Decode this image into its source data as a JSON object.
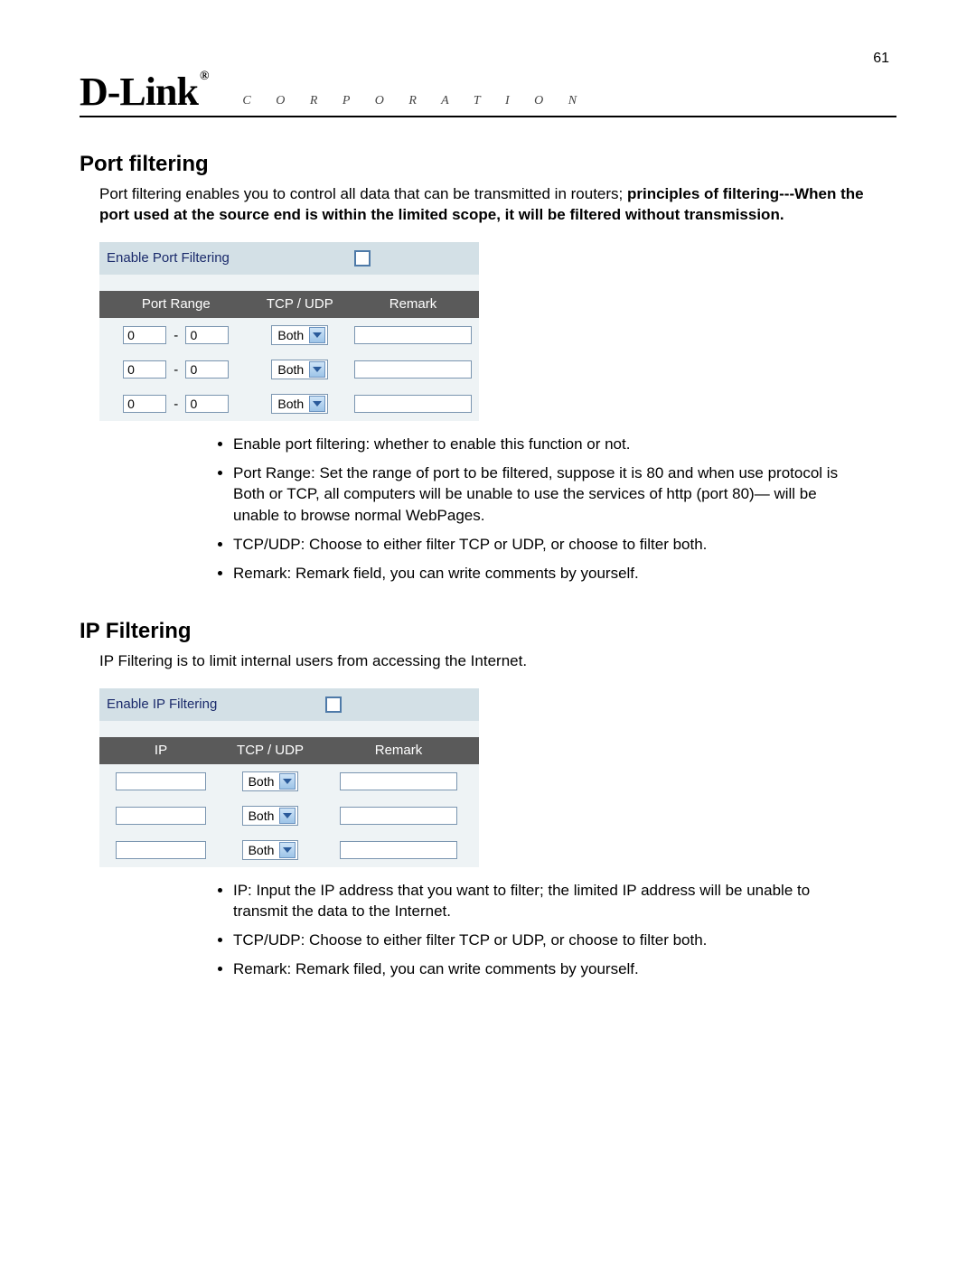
{
  "page_number": "61",
  "brand": {
    "logo_text": "D-Link",
    "registered": "®",
    "subtitle": "C O R P O R A T I O N"
  },
  "port_filtering": {
    "heading": "Port filtering",
    "intro_plain": "Port filtering enables you to control all data that can be transmitted in routers; ",
    "intro_bold": "principles of filtering---When the port used at the source end is within the limited scope, it will be filtered without transmission.",
    "enable_label": "Enable Port Filtering",
    "enable_checked": false,
    "columns": {
      "c1": "Port Range",
      "c2": "TCP / UDP",
      "c3": "Remark"
    },
    "rows": [
      {
        "from": "0",
        "to": "0",
        "proto": "Both",
        "remark": ""
      },
      {
        "from": "0",
        "to": "0",
        "proto": "Both",
        "remark": ""
      },
      {
        "from": "0",
        "to": "0",
        "proto": "Both",
        "remark": ""
      }
    ],
    "bullets": [
      "Enable port filtering: whether to enable this function or not.",
      "Port Range: Set the range of port to be filtered, suppose it is 80 and when use protocol is Both or TCP, all computers will be unable to use the services of http (port 80)— will be unable to browse normal WebPages.",
      "TCP/UDP: Choose to either filter TCP or UDP, or choose to filter both.",
      "Remark: Remark field, you can write comments by yourself."
    ]
  },
  "ip_filtering": {
    "heading": "IP Filtering",
    "intro": "IP Filtering is to limit internal users from accessing the Internet.",
    "enable_label": "Enable IP Filtering",
    "enable_checked": false,
    "columns": {
      "c1": "IP",
      "c2": "TCP / UDP",
      "c3": "Remark"
    },
    "rows": [
      {
        "ip": "",
        "proto": "Both",
        "remark": ""
      },
      {
        "ip": "",
        "proto": "Both",
        "remark": ""
      },
      {
        "ip": "",
        "proto": "Both",
        "remark": ""
      }
    ],
    "bullets": [
      "IP: Input the IP address that you want to filter; the limited IP address will be unable to transmit the data to the Internet.",
      "TCP/UDP: Choose to either filter TCP or UDP, or choose to filter both.",
      "Remark: Remark filed, you can write comments by yourself."
    ]
  }
}
